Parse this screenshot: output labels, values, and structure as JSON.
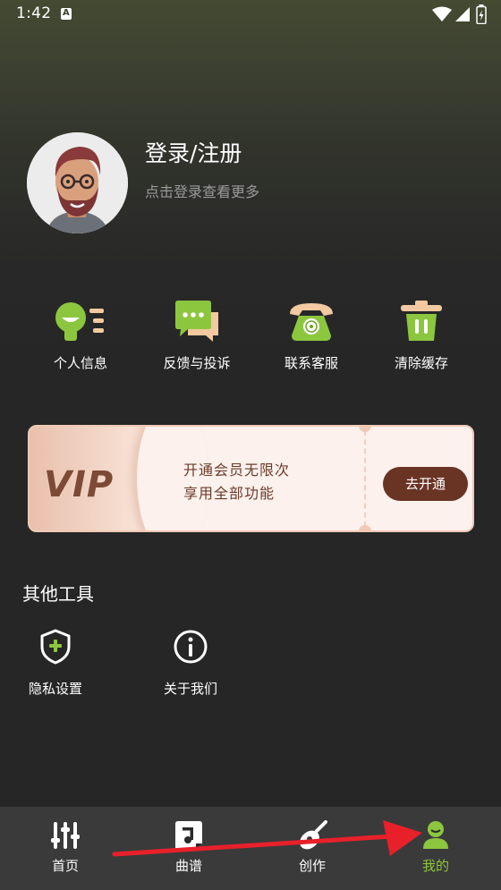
{
  "status_bar": {
    "time": "1:42",
    "notification_letter": "A"
  },
  "profile": {
    "title": "登录/注册",
    "subtitle": "点击登录查看更多"
  },
  "quick_actions": [
    {
      "label": "个人信息",
      "icon": "person-info-icon"
    },
    {
      "label": "反馈与投诉",
      "icon": "chat-bubble-icon"
    },
    {
      "label": "联系客服",
      "icon": "telephone-icon"
    },
    {
      "label": "清除缓存",
      "icon": "trash-icon"
    }
  ],
  "vip": {
    "logo_text": "VIP",
    "promo_line1": "开通会员无限次",
    "promo_line2": "享用全部功能",
    "button_label": "去开通"
  },
  "other_tools": {
    "title": "其他工具",
    "items": [
      {
        "label": "隐私设置",
        "icon": "shield-plus-icon"
      },
      {
        "label": "关于我们",
        "icon": "info-circle-icon"
      }
    ]
  },
  "bottom_nav": {
    "items": [
      {
        "label": "首页",
        "icon": "sliders-icon",
        "active": false
      },
      {
        "label": "曲谱",
        "icon": "music-sheet-icon",
        "active": false
      },
      {
        "label": "创作",
        "icon": "guitar-icon",
        "active": false
      },
      {
        "label": "我的",
        "icon": "user-icon",
        "active": true
      }
    ]
  },
  "colors": {
    "accent_green": "#8cc63f",
    "vip_brown": "#6a3424",
    "annotation_red": "#e8202a"
  }
}
